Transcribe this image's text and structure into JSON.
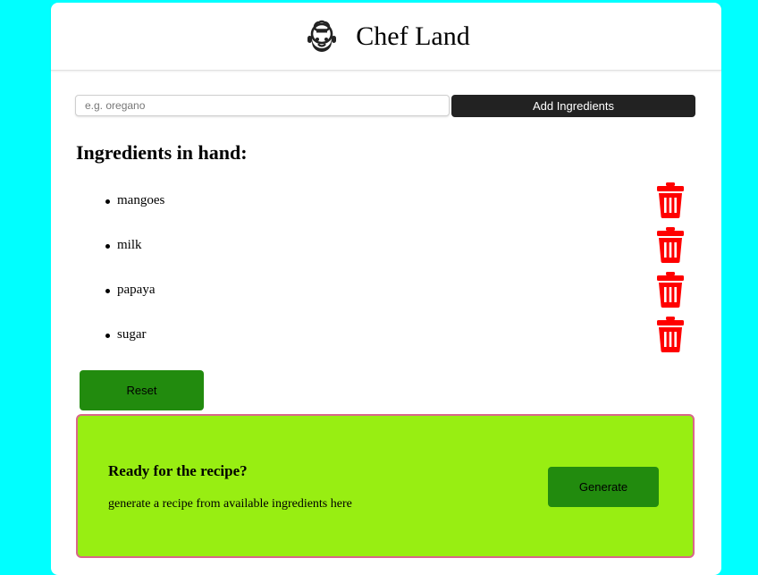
{
  "header": {
    "title": "Chef Land",
    "logo_icon": "chef-icon"
  },
  "search": {
    "placeholder": "e.g. oregano",
    "value": ""
  },
  "add_button_label": "Add Ingredients",
  "ingredients_heading": "Ingredients in hand:",
  "ingredients": [
    {
      "name": "mangoes",
      "delete_icon": "trash-icon"
    },
    {
      "name": "milk",
      "delete_icon": "trash-icon"
    },
    {
      "name": "papaya",
      "delete_icon": "trash-icon"
    },
    {
      "name": "sugar",
      "delete_icon": "trash-icon"
    }
  ],
  "reset_button_label": "Reset",
  "recipe_panel": {
    "title": "Ready for the recipe?",
    "description": "generate a recipe from available ingredients here",
    "generate_label": "Generate"
  },
  "colors": {
    "page_background": "#00ffff",
    "card_background": "#ffffff",
    "add_button": "#222222",
    "delete_icon": "#ff0000",
    "action_button": "#228b0e",
    "recipe_panel_background": "#98ee12",
    "recipe_panel_border": "#d9668a"
  }
}
